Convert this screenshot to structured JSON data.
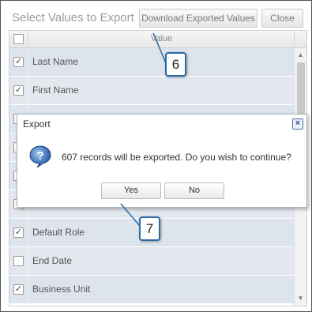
{
  "header": {
    "title": "Select Values to Export",
    "download_label": "Download Exported Values",
    "close_label": "Close"
  },
  "grid": {
    "column_value": "Value",
    "rows": [
      {
        "label": "Last Name",
        "checked": true
      },
      {
        "label": "First Name",
        "checked": true
      },
      {
        "label": "",
        "checked": false
      },
      {
        "label": "",
        "checked": false
      },
      {
        "label": "",
        "checked": false
      },
      {
        "label": "",
        "checked": false
      },
      {
        "label": "Default Role",
        "checked": true
      },
      {
        "label": "End Date",
        "checked": false
      },
      {
        "label": "Business Unit",
        "checked": true
      }
    ]
  },
  "dialog": {
    "title": "Export",
    "message": "607 records will be exported. Do you wish to continue?",
    "yes_label": "Yes",
    "no_label": "No",
    "icon": "question-icon",
    "close_icon": "close-icon"
  },
  "callouts": {
    "first": "6",
    "second": "7"
  },
  "colors": {
    "row_bg": "#dde4ec",
    "callout_border": "#2b6aa7"
  }
}
